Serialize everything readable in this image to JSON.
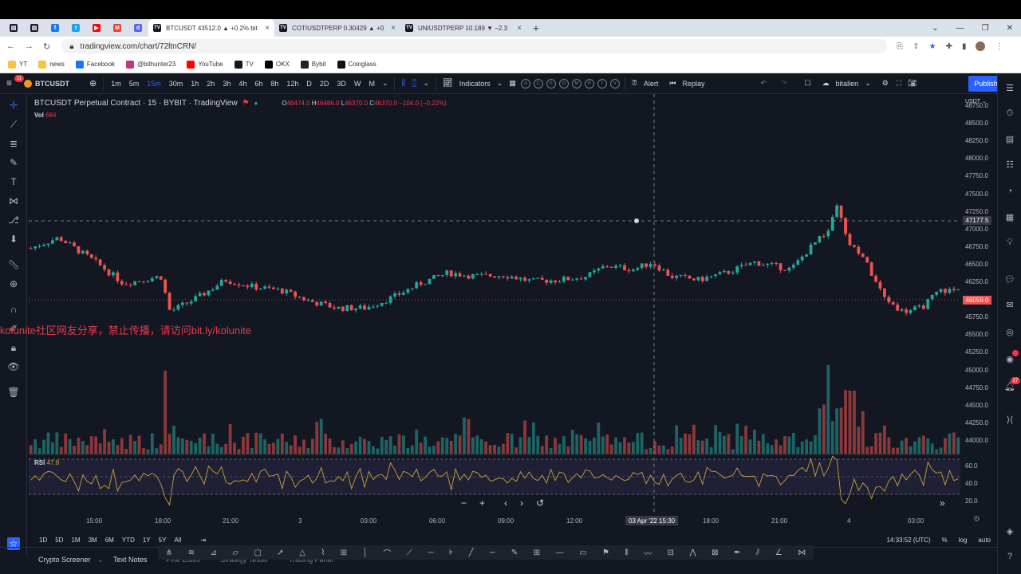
{
  "browser": {
    "pinned_tabs": [
      {
        "icon": "news-icon",
        "color": "#1a1a2e",
        "glyph": "▤"
      },
      {
        "icon": "news-icon",
        "color": "#1a1a2e",
        "glyph": "▤"
      },
      {
        "icon": "facebook-icon",
        "color": "#1877f2",
        "glyph": "f"
      },
      {
        "icon": "twitter-icon",
        "color": "#1da1f2",
        "glyph": "t"
      },
      {
        "icon": "youtube-icon",
        "color": "#ff0000",
        "glyph": "▶"
      },
      {
        "icon": "gmail-icon",
        "color": "#ea4335",
        "glyph": "M"
      },
      {
        "icon": "discord-icon",
        "color": "#5865f2",
        "glyph": "d"
      }
    ],
    "tabs": [
      {
        "title": "BTCUSDT 43512.0 ▲ +0.2% bit",
        "active": true
      },
      {
        "title": "COTIUSDTPERP 0.30429 ▲ +0",
        "active": false
      },
      {
        "title": "UNIUSDTPERP 10.189 ▼ −2.3",
        "active": false
      }
    ],
    "url": "tradingview.com/chart/72ltnCRN/",
    "bookmarks": [
      {
        "label": "YT",
        "icon": "folder-icon",
        "color": "#f5c542"
      },
      {
        "label": "news",
        "icon": "folder-icon",
        "color": "#f5c542"
      },
      {
        "label": "Facebook",
        "icon": "facebook-icon",
        "color": "#1877f2"
      },
      {
        "label": "@bithunter23",
        "icon": "instagram-icon",
        "color": "#c13584"
      },
      {
        "label": "YouTube",
        "icon": "youtube-icon",
        "color": "#ff0000"
      },
      {
        "label": "TV",
        "icon": "tradingview-icon",
        "color": "#131722"
      },
      {
        "label": "OKX",
        "icon": "okx-icon",
        "color": "#000000"
      },
      {
        "label": "Bybit",
        "icon": "bybit-icon",
        "color": "#222222"
      },
      {
        "label": "Coinglass",
        "icon": "coinglass-icon",
        "color": "#111111"
      }
    ]
  },
  "toolbar": {
    "menu_badge": "11",
    "symbol": "BTCUSDT",
    "intervals": [
      "1m",
      "5m",
      "15m",
      "30m",
      "1h",
      "2h",
      "3h",
      "4h",
      "6h",
      "8h",
      "12h",
      "D",
      "2D",
      "3D",
      "W",
      "M"
    ],
    "active_interval": "15m",
    "indicators_label": "Indicators",
    "template_letters": [
      "A",
      "C",
      "E",
      "G",
      "M",
      "R",
      "T",
      "V"
    ],
    "alert_label": "Alert",
    "replay_label": "Replay",
    "layout_name": "bitallen",
    "publish_label": "Publish"
  },
  "legend": {
    "title": "BTCUSDT Perpetual Contract · 15 · BYBIT · TradingView",
    "open": "46474.0",
    "high": "46486.0",
    "low": "46370.0",
    "close": "46370.0",
    "change": "−104.0 (−0.22%)",
    "vol_label": "Vol",
    "vol_value": "684",
    "currency": "USDT"
  },
  "watermark": "kolunite社区网友分享，禁止传播，请访问bit.ly/kolunite",
  "price_scale": [
    "48750.0",
    "48500.0",
    "48250.0",
    "48000.0",
    "47750.0",
    "47500.0",
    "47250.0",
    "47000.0",
    "46750.0",
    "46500.0",
    "46250.0",
    "46000.0",
    "45750.0",
    "45500.0",
    "45250.0",
    "45000.0",
    "44750.0",
    "44500.0",
    "44250.0",
    "44000.0"
  ],
  "crosshair_price": "47177.5",
  "last_price": "46059.0",
  "rsi": {
    "label": "RSI",
    "value": "47.8",
    "scale": [
      "60.0",
      "40.0",
      "20.0"
    ]
  },
  "time_axis": [
    "15:00",
    "18:00",
    "21:00",
    "3",
    "03:00",
    "06:00",
    "09:00",
    "12:00",
    "18:00",
    "21:00",
    "4",
    "03:00"
  ],
  "crosshair_time": "03 Apr '22   15:30",
  "ranges": [
    "1D",
    "5D",
    "1M",
    "3M",
    "6M",
    "YTD",
    "1Y",
    "5Y",
    "All"
  ],
  "clock": "14:33:52 (UTC)",
  "scale_options": [
    "%",
    "log",
    "auto"
  ],
  "panels": [
    "Crypto Screener",
    "Text Notes",
    "Pine Editor",
    "Strategy Tester",
    "Trading Panel"
  ],
  "colors": {
    "up": "#26a69a",
    "down": "#ef5350",
    "background": "#131722",
    "accent": "#2962ff",
    "rsi_line": "#c9a23a"
  }
}
